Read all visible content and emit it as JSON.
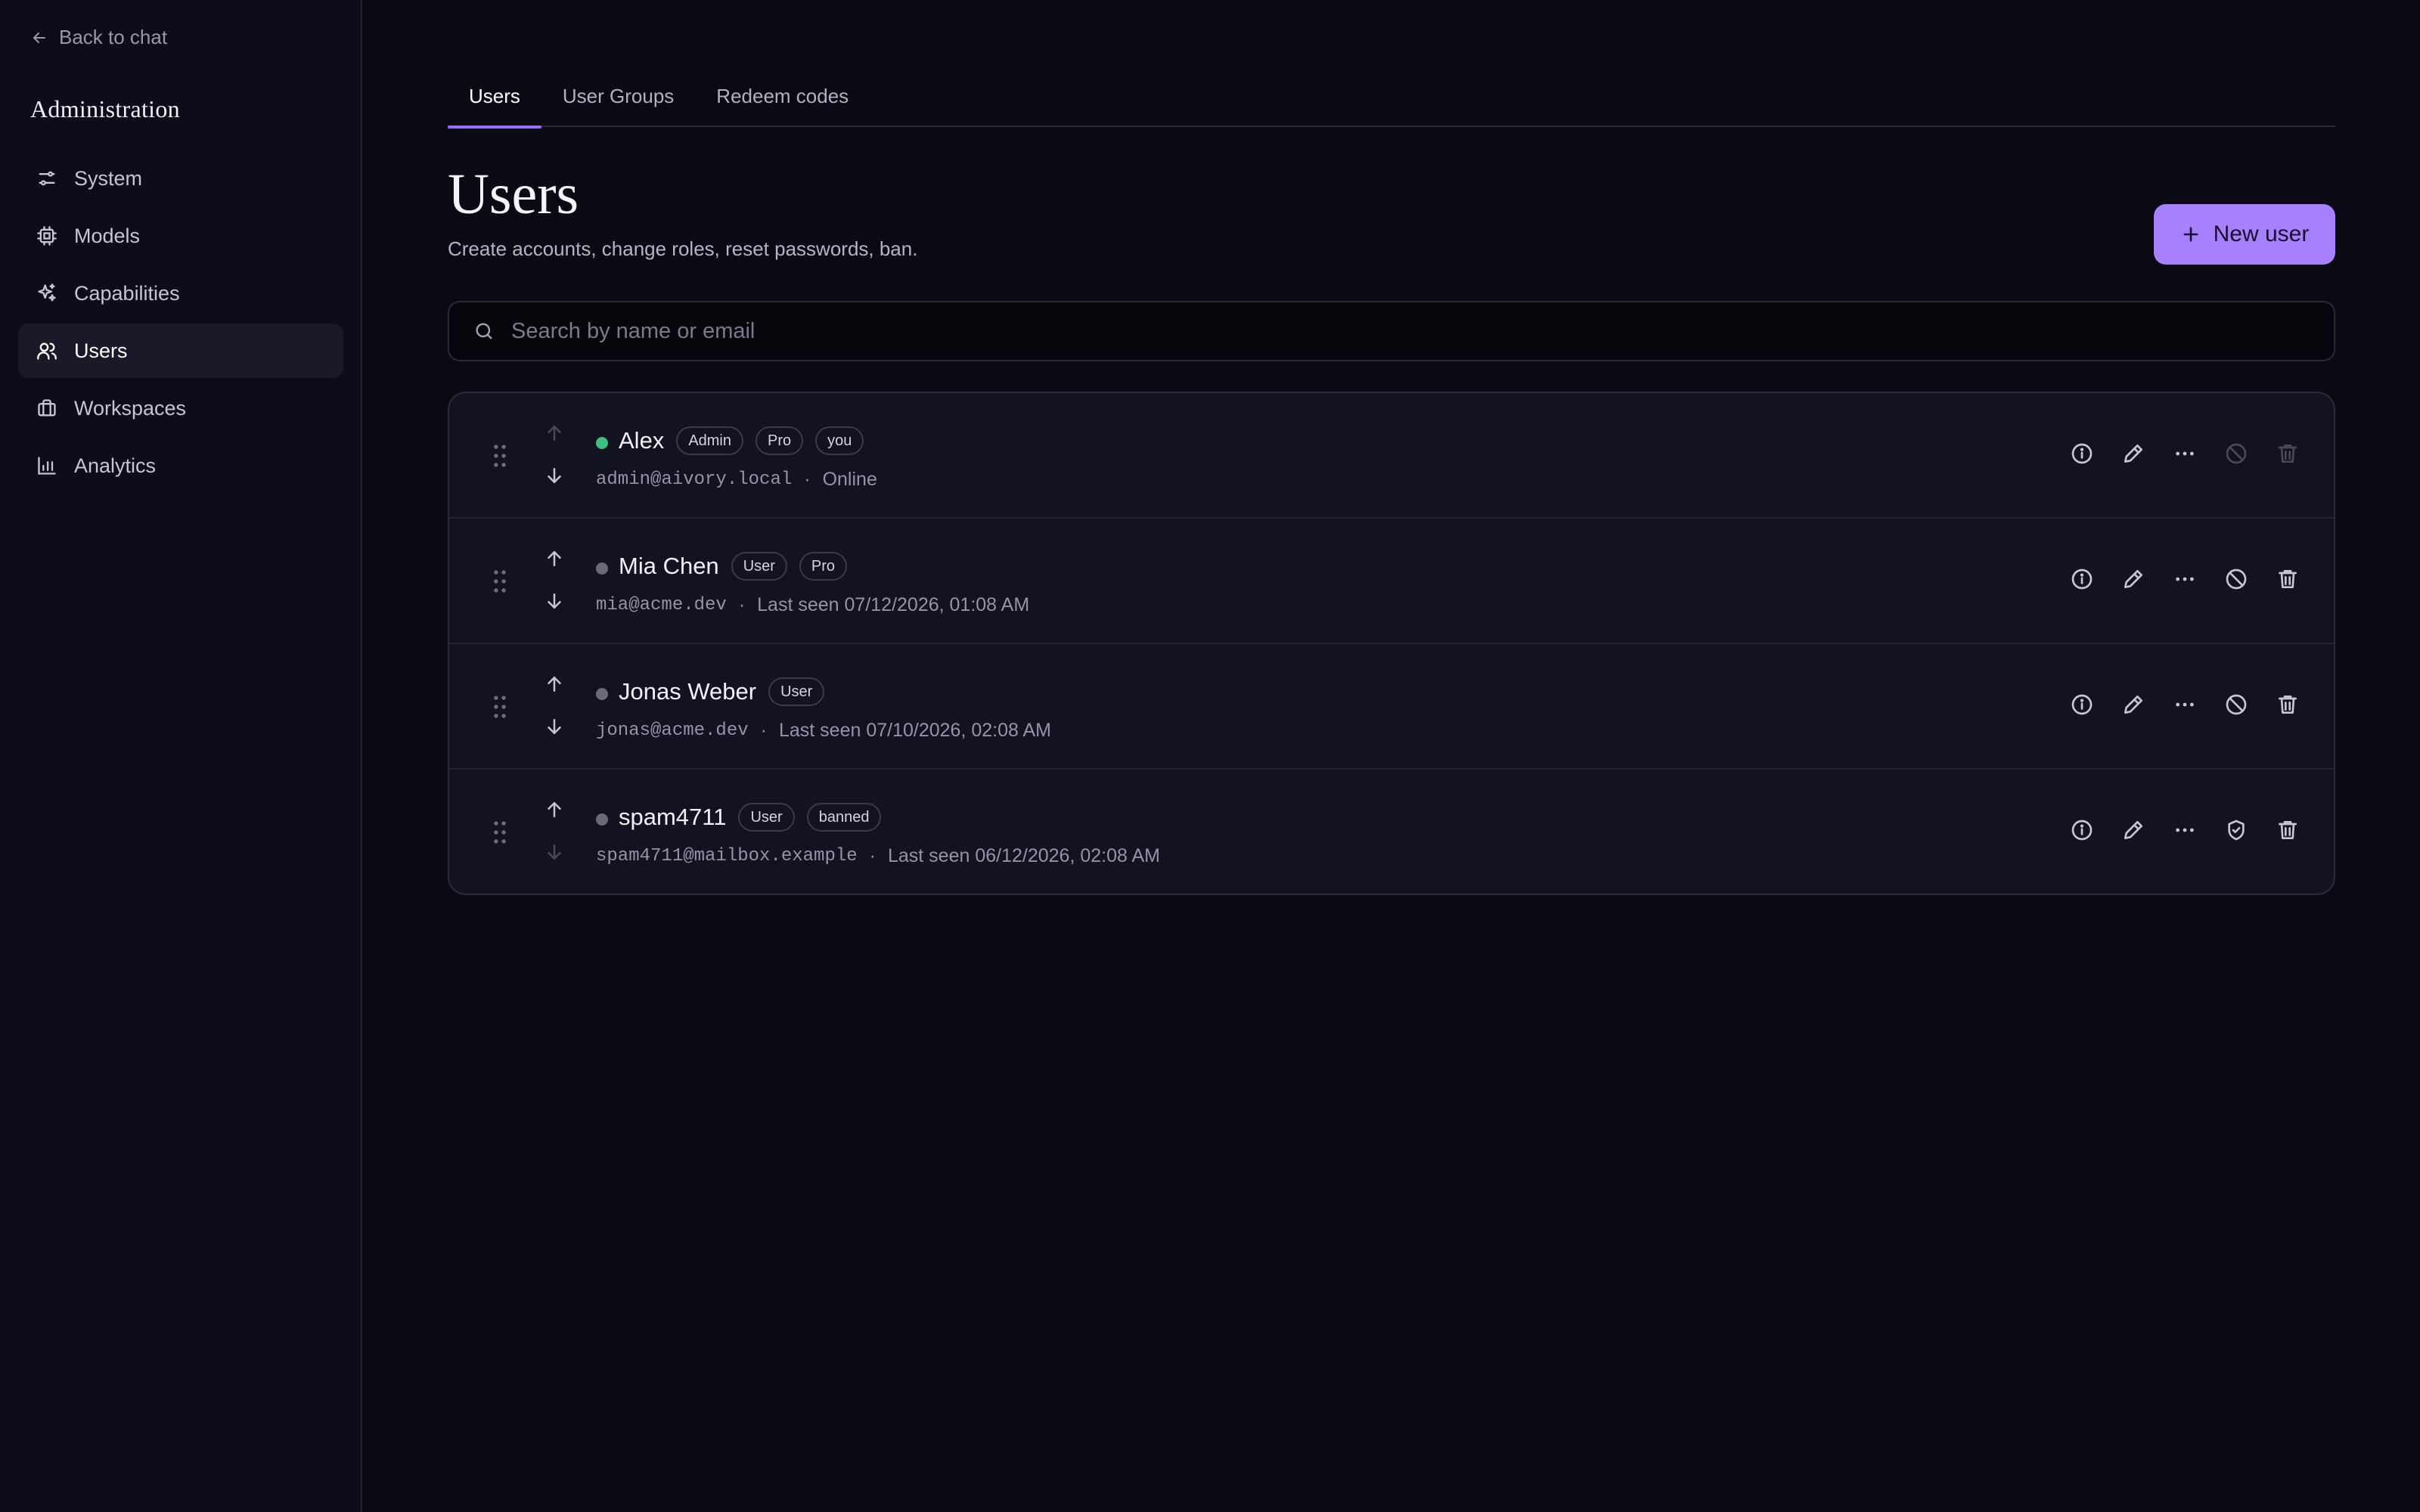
{
  "sidebar": {
    "back_label": "Back to chat",
    "title": "Administration",
    "items": [
      {
        "label": "System",
        "icon": "sliders-icon"
      },
      {
        "label": "Models",
        "icon": "cpu-icon"
      },
      {
        "label": "Capabilities",
        "icon": "sparkles-icon"
      },
      {
        "label": "Users",
        "icon": "users-icon",
        "active": true
      },
      {
        "label": "Workspaces",
        "icon": "briefcase-icon"
      },
      {
        "label": "Analytics",
        "icon": "bar-chart-icon"
      }
    ]
  },
  "tabs": [
    {
      "label": "Users",
      "active": true
    },
    {
      "label": "User Groups"
    },
    {
      "label": "Redeem codes"
    }
  ],
  "page": {
    "title": "Users",
    "subtitle": "Create accounts, change roles, reset passwords, ban.",
    "new_user_label": "New user"
  },
  "search": {
    "placeholder": "Search by name or email",
    "value": ""
  },
  "users": [
    {
      "name": "Alex",
      "badges": [
        "Admin",
        "Pro",
        "you"
      ],
      "email": "admin@aivory.local",
      "sep": "·",
      "status": "Online",
      "online": true,
      "can_move_up": false,
      "can_move_down": true,
      "ban_disabled": true,
      "delete_disabled": true,
      "banned": false
    },
    {
      "name": "Mia Chen",
      "badges": [
        "User",
        "Pro"
      ],
      "email": "mia@acme.dev",
      "sep": "·",
      "status": "Last seen 07/12/2026, 01:08 AM",
      "online": false,
      "can_move_up": true,
      "can_move_down": true,
      "ban_disabled": false,
      "delete_disabled": false,
      "banned": false
    },
    {
      "name": "Jonas Weber",
      "badges": [
        "User"
      ],
      "email": "jonas@acme.dev",
      "sep": "·",
      "status": "Last seen 07/10/2026, 02:08 AM",
      "online": false,
      "can_move_up": true,
      "can_move_down": true,
      "ban_disabled": false,
      "delete_disabled": false,
      "banned": false
    },
    {
      "name": "spam4711",
      "badges": [
        "User",
        "banned"
      ],
      "email": "spam4711@mailbox.example",
      "sep": "·",
      "status": "Last seen 06/12/2026, 02:08 AM",
      "online": false,
      "can_move_up": true,
      "can_move_down": false,
      "ban_disabled": false,
      "delete_disabled": false,
      "banned": true
    }
  ],
  "colors": {
    "accent": "#a680ff",
    "tab_underline": "#9b6bff",
    "online": "#3fbf7f",
    "offline": "#6b6878"
  }
}
